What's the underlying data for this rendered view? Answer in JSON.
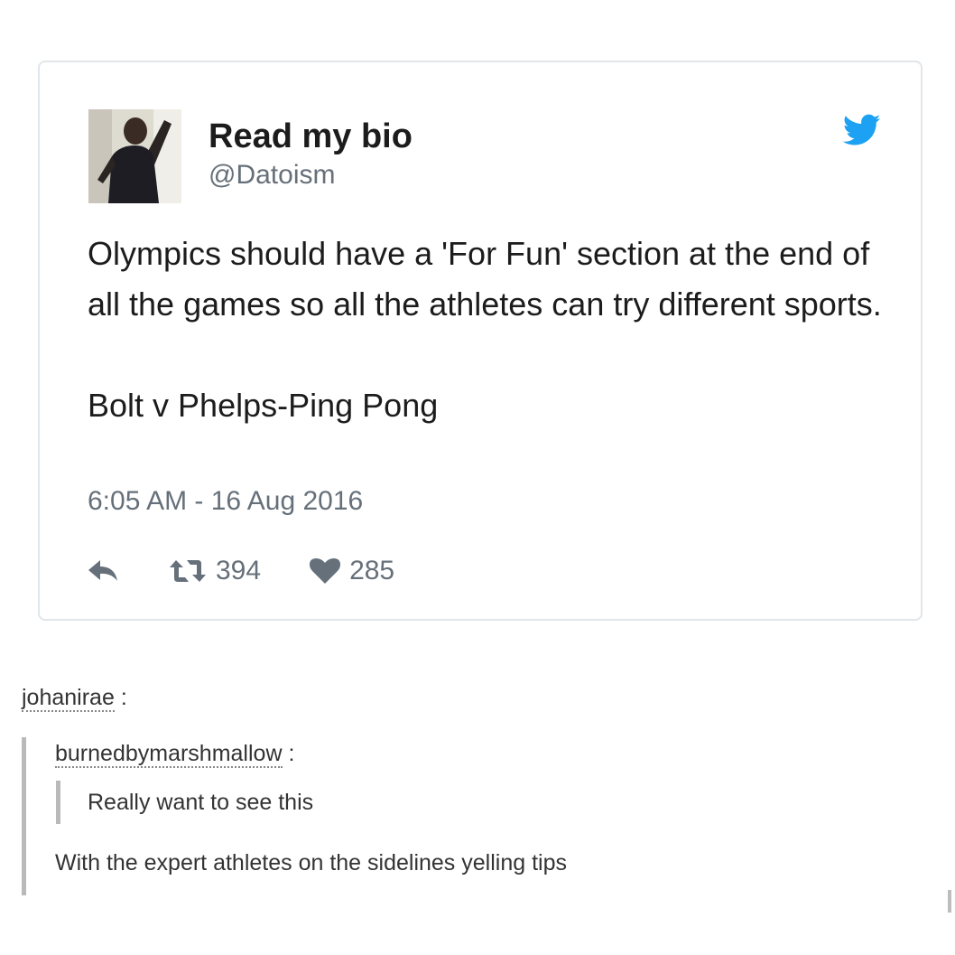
{
  "tweet": {
    "display_name": "Read my bio",
    "handle": "@Datoism",
    "text_paragraph_1": "Olympics should have a 'For Fun' section at the end of all the games so all the athletes can try different sports.",
    "text_paragraph_2": "Bolt v Phelps-Ping Pong",
    "timestamp": "6:05 AM - 16 Aug 2016",
    "retweet_count": "394",
    "like_count": "285",
    "icons": {
      "brand": "twitter-bird-icon",
      "reply": "reply-arrow-icon",
      "retweet": "retweet-icon",
      "like": "heart-icon"
    }
  },
  "reblog": {
    "outer_user": "johanirae",
    "inner_user": "burnedbymarshmallow",
    "separator": ":",
    "inner_text": "Really want to see this",
    "reply_text": "With the expert athletes on the sidelines yelling tips"
  },
  "colors": {
    "twitter_blue": "#1da1f2",
    "muted_gray": "#66707a",
    "text_dark": "#1c1c1c",
    "quote_bar": "#b9b9b9"
  }
}
